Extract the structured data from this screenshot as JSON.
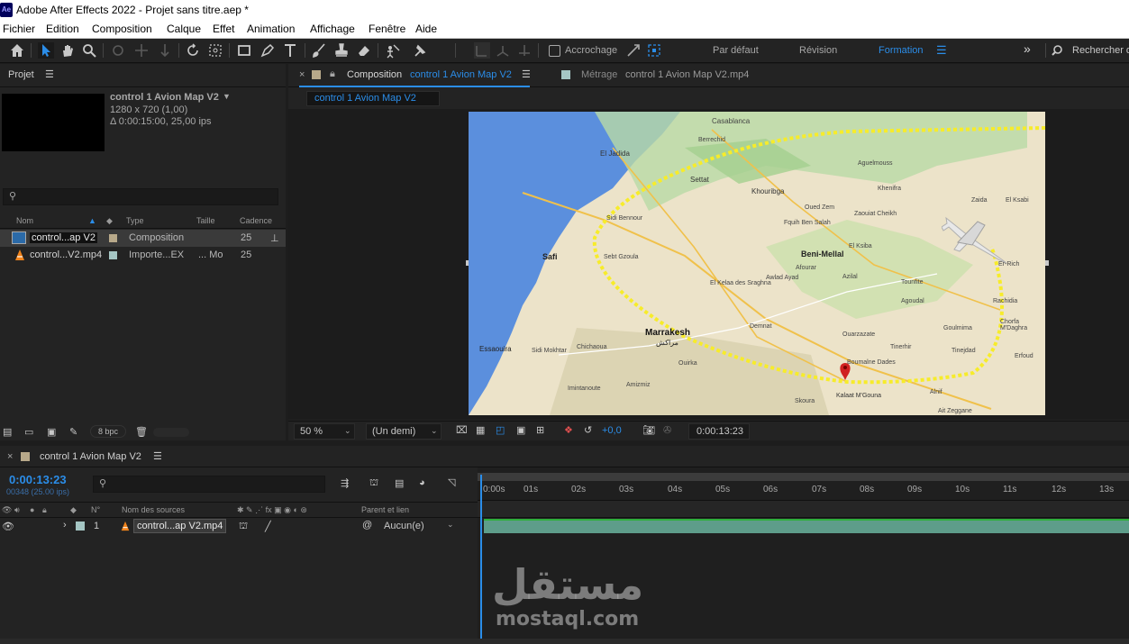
{
  "window": {
    "title": "Adobe After Effects 2022 - Projet sans titre.aep *",
    "logo": "Ae"
  },
  "menu": [
    "Fichier",
    "Edition",
    "Composition",
    "Calque",
    "Effet",
    "Animation",
    "Affichage",
    "Fenêtre",
    "Aide"
  ],
  "toolbar": {
    "snap_label": "Accrochage",
    "workspaces": [
      "Par défaut",
      "Révision",
      "Formation"
    ],
    "active_workspace": "Formation",
    "search_placeholder": "Rechercher d",
    "more": "»"
  },
  "project": {
    "title": "Projet",
    "selected_name": "control 1 Avion Map V2",
    "selected_info_1": "1280 x 720 (1,00)",
    "selected_info_2": "Δ 0:00:15:00, 25,00 ips",
    "columns": [
      "Nom",
      "Type",
      "Taille",
      "Cadence"
    ],
    "items": [
      {
        "name": "control...ap V2",
        "type": "Composition",
        "size": "",
        "rate": "25",
        "icon": "composition-icon"
      },
      {
        "name": "control...V2.mp4",
        "type": "Importe...EX",
        "size": "... Mo",
        "rate": "25",
        "icon": "vlc-cone-icon"
      }
    ],
    "bpc": "8 bpc"
  },
  "viewer": {
    "comp_tab_prefix": "Composition",
    "comp_tab_name": "control 1 Avion Map V2",
    "footage_tab_prefix": "Métrage",
    "footage_tab_name": "control 1 Avion Map V2.mp4",
    "subtab": "control 1 Avion Map V2",
    "zoom": "50 %",
    "resolution": "(Un demi)",
    "exposure": "+0,0",
    "timecode": "0:00:13:23"
  },
  "map": {
    "labels": [
      "Casablanca",
      "El Jadida",
      "Settat",
      "Khouribga",
      "Oued Zem",
      "Berrechid",
      "Zaida",
      "El Ksabi",
      "Aguelmouss",
      "Khenifra",
      "Sidi Bennour",
      "Zaouiat Cheikh",
      "Beni-Mellal",
      "Fquih Ben Salah",
      "El Ksiba",
      "Safi",
      "Sebt Gzoula",
      "El Kelaa des Sraghna",
      "Afourar",
      "Awlad Ayad",
      "Azilal",
      "Er-Rich",
      "Marrakesh",
      "مراكش",
      "Essaouira",
      "Demnat",
      "Ouarzazate",
      "Boumalne Dades",
      "Tinerhir",
      "Rachidia",
      "Goulmima",
      "Kalaat M'Gouna",
      "Skoura",
      "Alnif",
      "Ait Zeggane",
      "Tinejdad",
      "Erfoud",
      "Imintanoute",
      "Chichaoua",
      "Amizmiz",
      "Ouirka",
      "Sidi Mokhtar",
      "Chorfa M'Daghra",
      "Tounfite",
      "Agoudal"
    ]
  },
  "timeline": {
    "comp_name": "control 1 Avion Map V2",
    "timecode": "0:00:13:23",
    "frame_info": "00348 (25.00 ips)",
    "columns": {
      "num": "N°",
      "source": "Nom des sources",
      "parent": "Parent et lien"
    },
    "layer": {
      "index": "1",
      "name": "control...ap V2.mp4",
      "parent": "Aucun(e)"
    },
    "ruler": [
      "0:00s",
      "01s",
      "02s",
      "03s",
      "04s",
      "05s",
      "06s",
      "07s",
      "08s",
      "09s",
      "10s",
      "11s",
      "12s",
      "13s"
    ]
  },
  "watermark": {
    "arabic": "مستقل",
    "latin": "mostaql.com"
  }
}
